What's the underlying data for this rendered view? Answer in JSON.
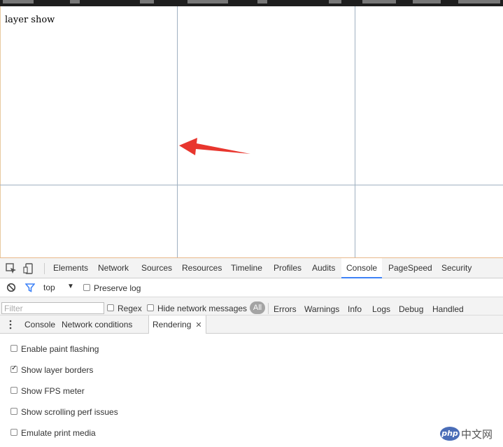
{
  "page": {
    "text": "layer show"
  },
  "devtools": {
    "tabs": [
      {
        "label": "Elements"
      },
      {
        "label": "Network"
      },
      {
        "label": "Sources"
      },
      {
        "label": "Resources"
      },
      {
        "label": "Timeline"
      },
      {
        "label": "Profiles"
      },
      {
        "label": "Audits"
      },
      {
        "label": "Console",
        "active": true
      },
      {
        "label": "PageSpeed"
      },
      {
        "label": "Security"
      }
    ],
    "console_toolbar": {
      "context": "top",
      "preserve_log_label": "Preserve log",
      "preserve_log_checked": false
    },
    "filter_bar": {
      "filter_placeholder": "Filter",
      "regex_label": "Regex",
      "hide_network_label": "Hide network messages",
      "all_label": "All",
      "levels": [
        "Errors",
        "Warnings",
        "Info",
        "Logs",
        "Debug",
        "Handled"
      ]
    },
    "drawer": {
      "tabs": [
        {
          "label": "Console"
        },
        {
          "label": "Network conditions"
        },
        {
          "label": "Rendering",
          "active": true,
          "closable": true
        }
      ],
      "close_glyph": "✕"
    },
    "rendering_options": [
      {
        "label": "Enable paint flashing",
        "checked": false
      },
      {
        "label": "Show layer borders",
        "checked": true
      },
      {
        "label": "Show FPS meter",
        "checked": false
      },
      {
        "label": "Show scrolling perf issues",
        "checked": false
      },
      {
        "label": "Emulate print media",
        "checked": false
      }
    ]
  },
  "watermark": {
    "logo": "php",
    "text": "中文网"
  },
  "colors": {
    "layer_border": "#9fb1c1",
    "arrow": "#e8362e",
    "active_tab_underline": "#3e82f7",
    "filter_icon": "#3e82f7"
  },
  "icons": {
    "inspect": "inspect-element-icon",
    "device": "device-mode-icon",
    "clear": "clear-console-icon",
    "filter": "filter-icon",
    "drawer_menu": "kebab-menu-icon"
  }
}
